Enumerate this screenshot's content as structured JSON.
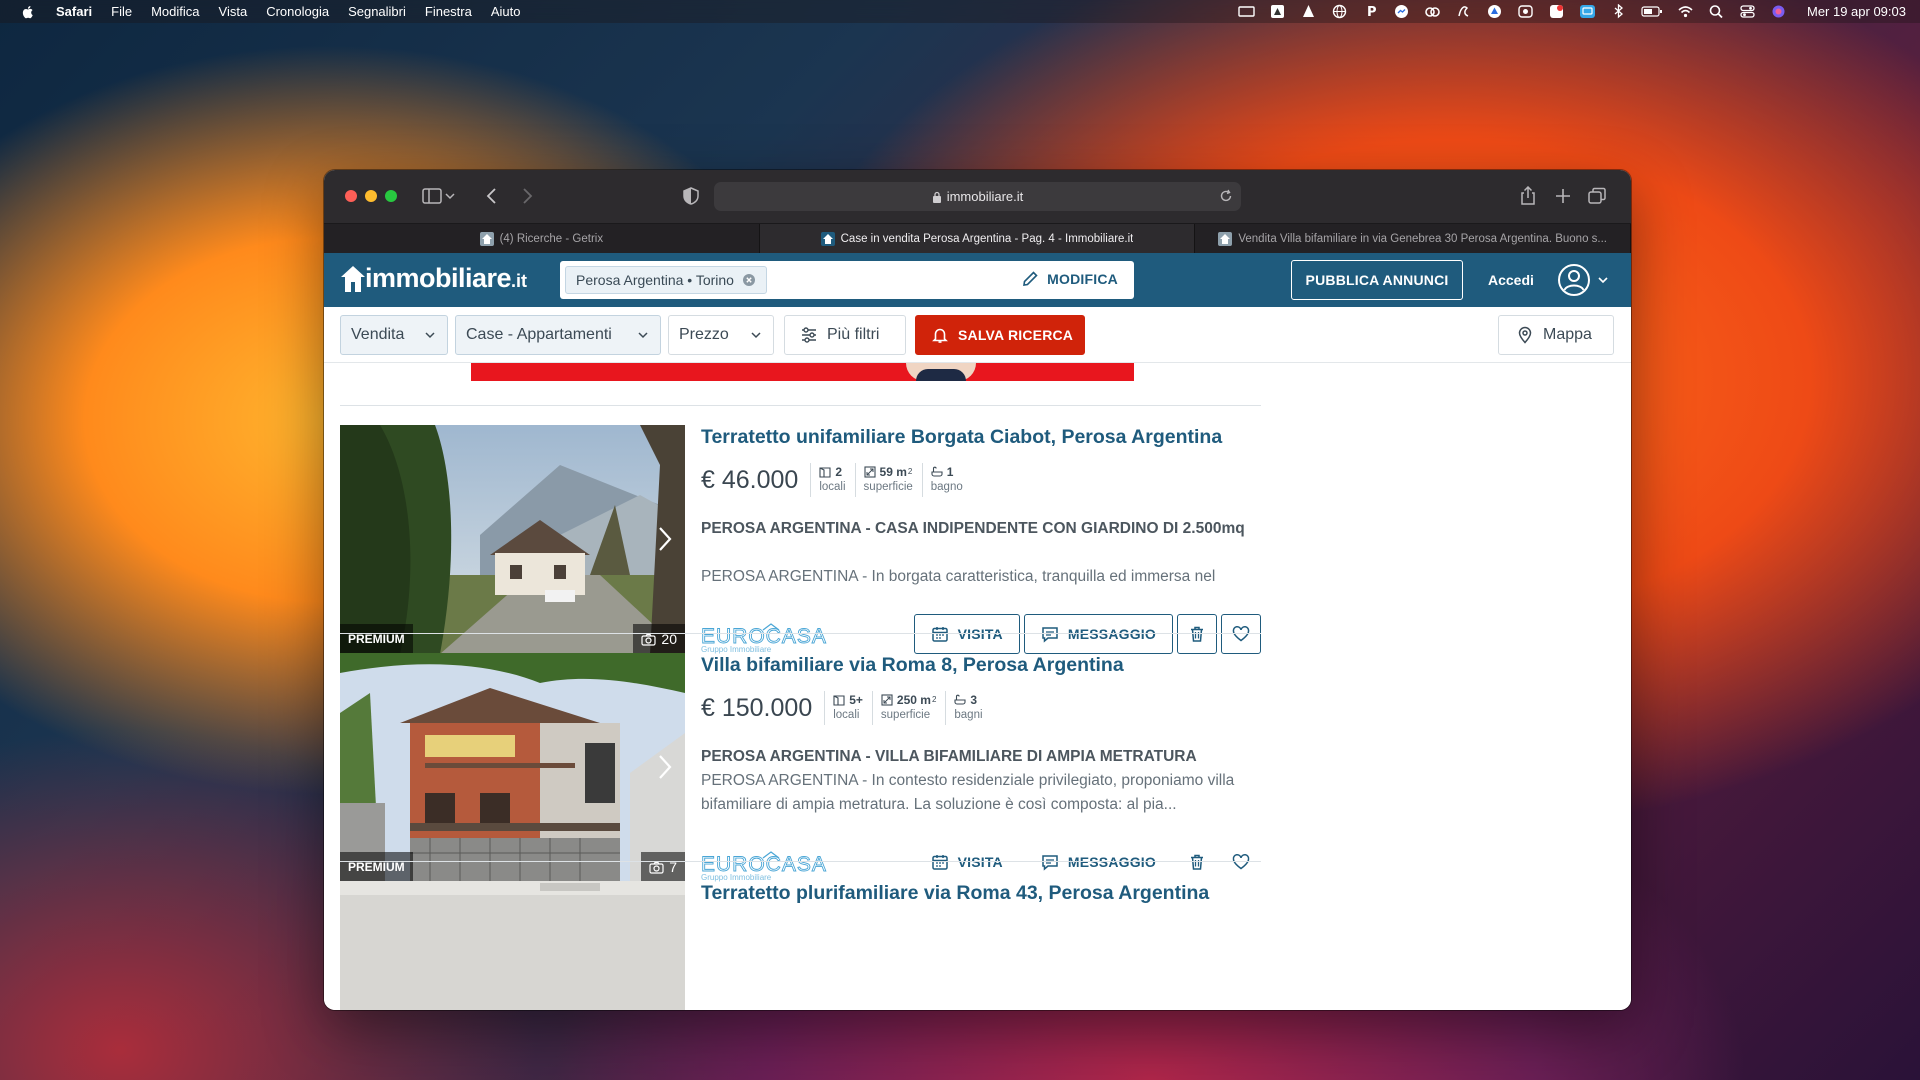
{
  "menubar": {
    "items": [
      "Safari",
      "File",
      "Modifica",
      "Vista",
      "Cronologia",
      "Segnalibri",
      "Finestra",
      "Aiuto"
    ],
    "clock": "Mer 19 apr 09:03"
  },
  "browser": {
    "url": "immobiliare.it",
    "tabs": [
      {
        "label": "(4) Ricerche - Getrix",
        "active": false
      },
      {
        "label": "Case in vendita Perosa Argentina - Pag. 4 - Immobiliare.it",
        "active": true
      },
      {
        "label": "Vendita Villa bifamiliare in via Genebrea 30 Perosa Argentina. Buono s...",
        "active": false
      }
    ]
  },
  "site": {
    "logo_text": "immobiliare",
    "logo_tld": ".it",
    "search_chip": "Perosa Argentina • Torino",
    "modifica_label": "MODIFICA",
    "pubblica_label": "PUBBLICA ANNUNCI",
    "accedi_label": "Accedi",
    "brand_color": "#1f5b7d",
    "accent_color": "#d0230a"
  },
  "filters": {
    "contract": "Vendita",
    "category": "Case - Appartamenti",
    "price": "Prezzo",
    "more": "Più filtri",
    "save": "SALVA RICERCA",
    "map": "Mappa"
  },
  "listings": [
    {
      "title": "Terratetto unifamiliare Borgata Ciabot, Perosa Argentina",
      "price": "€ 46.000",
      "rooms_value": "2",
      "rooms_label": "locali",
      "area_value": "59 m",
      "area_sup": "2",
      "area_label": "superficie",
      "baths_value": "1",
      "baths_label": "bagno",
      "desc_title": "PEROSA ARGENTINA - CASA INDIPENDENTE CON GIARDINO DI 2.500mq",
      "desc_text": "PEROSA ARGENTINA - In borgata caratteristica, tranquilla ed immersa nel",
      "badge": "PREMIUM",
      "photo_count": "20",
      "visit_label": "VISITA",
      "message_label": "MESSAGGIO",
      "agency_alt": "EUROCASA Gruppo Immobiliare"
    },
    {
      "title": "Villa bifamiliare via Roma 8, Perosa Argentina",
      "price": "€ 150.000",
      "rooms_value": "5+",
      "rooms_label": "locali",
      "area_value": "250 m",
      "area_sup": "2",
      "area_label": "superficie",
      "baths_value": "3",
      "baths_label": "bagni",
      "desc_title": "PEROSA ARGENTINA - VILLA BIFAMILIARE DI AMPIA METRATURA",
      "desc_text": "PEROSA ARGENTINA - In contesto residenziale privilegiato, proponiamo villa bifamiliare di ampia metratura. La soluzione è così composta: al pia...",
      "badge": "PREMIUM",
      "photo_count": "7",
      "visit_label": "VISITA",
      "message_label": "MESSAGGIO",
      "agency_alt": "EUROCASA Gruppo Immobiliare"
    },
    {
      "title": "Terratetto plurifamiliare via Roma 43, Perosa Argentina"
    }
  ]
}
